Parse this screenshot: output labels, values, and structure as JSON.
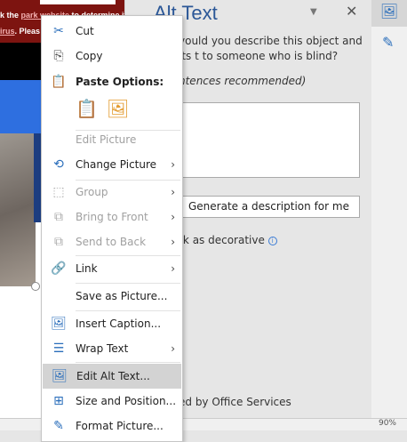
{
  "document": {
    "banner_line1_pre": "k the ",
    "banner_link1": "park website",
    "banner_line1_post": " to determine its c",
    "banner_link2": "irus",
    "banner_line2_post": ". Pleas"
  },
  "alt_text_pane": {
    "title": "Alt Text",
    "question": "vould you describe this object and its t to someone who is blind?",
    "hint": "ntences recommended)",
    "generate_button": "Generate a description for me",
    "decorative_label": "rk as decorative",
    "services_text": "ed by Office Services"
  },
  "context_menu": {
    "items": [
      {
        "label": "Cut",
        "icon": "scissors-icon"
      },
      {
        "label": "Copy",
        "icon": "copy-icon"
      },
      {
        "label": "Paste Options:",
        "icon": "clipboard-icon"
      },
      {
        "label": "Edit Picture",
        "disabled": true
      },
      {
        "label": "Change Picture",
        "icon": "change-picture-icon",
        "submenu": true
      },
      {
        "label": "Group",
        "icon": "group-icon",
        "disabled": true,
        "submenu": true
      },
      {
        "label": "Bring to Front",
        "icon": "bring-front-icon",
        "disabled": true,
        "submenu": true
      },
      {
        "label": "Send to Back",
        "icon": "send-back-icon",
        "disabled": true,
        "submenu": true
      },
      {
        "label": "Link",
        "icon": "link-icon",
        "submenu": true
      },
      {
        "label": "Save as Picture..."
      },
      {
        "label": "Insert Caption...",
        "icon": "caption-icon"
      },
      {
        "label": "Wrap Text",
        "icon": "wrap-text-icon",
        "submenu": true
      },
      {
        "label": "Edit Alt Text...",
        "icon": "alt-text-icon",
        "highlighted": true
      },
      {
        "label": "Size and Position...",
        "icon": "size-position-icon"
      },
      {
        "label": "Format Picture...",
        "icon": "format-picture-icon"
      }
    ]
  },
  "status_bar": {
    "zoom": "90%"
  }
}
